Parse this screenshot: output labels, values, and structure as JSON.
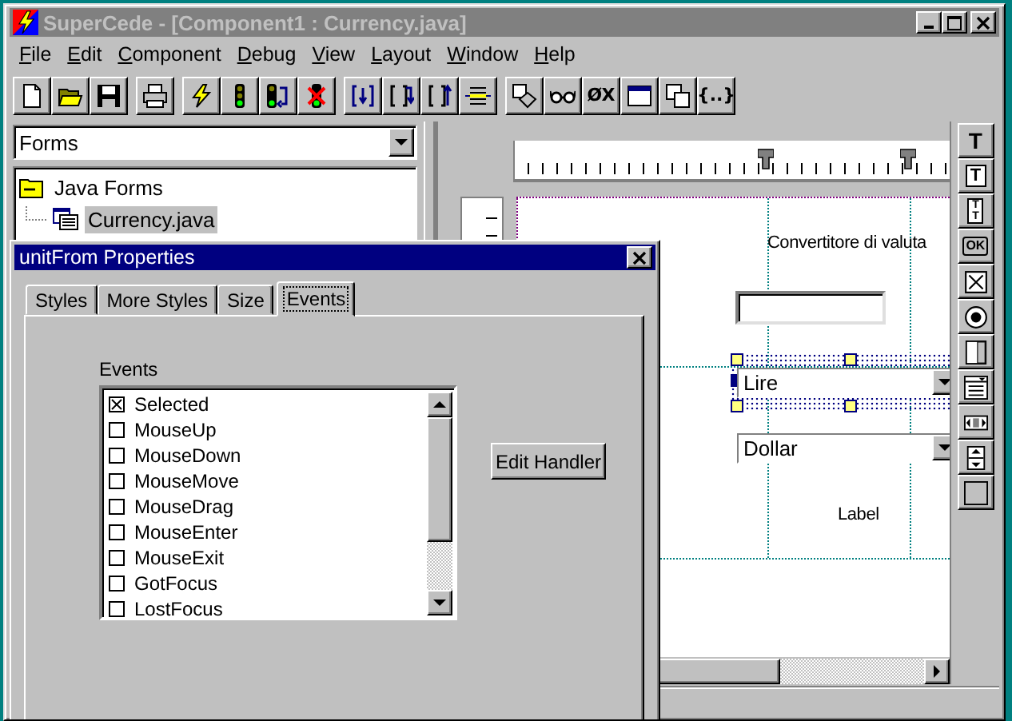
{
  "window": {
    "title": "SuperCede - [Component1 : Currency.java]",
    "active": false
  },
  "menu": [
    "File",
    "Edit",
    "Component",
    "Debug",
    "View",
    "Layout",
    "Window",
    "Help"
  ],
  "toolbar": [
    {
      "buttons": [
        {
          "kind": "new"
        },
        {
          "kind": "open"
        },
        {
          "kind": "save"
        }
      ]
    },
    {
      "buttons": [
        {
          "kind": "print"
        }
      ]
    },
    {
      "buttons": [
        {
          "kind": "lightning"
        },
        {
          "kind": "traffic"
        },
        {
          "kind": "traffic-arrow"
        },
        {
          "kind": "traffic-cross"
        }
      ]
    },
    {
      "buttons": [
        {
          "kind": "bracket-down"
        },
        {
          "kind": "bracket-right"
        },
        {
          "kind": "bracket-up"
        },
        {
          "kind": "center"
        }
      ]
    },
    {
      "buttons": [
        {
          "kind": "shapes"
        },
        {
          "kind": "glasses"
        },
        {
          "kind": "glyph",
          "label": "ØX"
        },
        {
          "kind": "window"
        },
        {
          "kind": "copy"
        },
        {
          "kind": "glyph",
          "label": "{..}"
        }
      ]
    }
  ],
  "forms_dropdown": {
    "value": "Forms"
  },
  "tree": [
    {
      "label": "Java Forms",
      "expanded": true,
      "children": [
        {
          "label": "Currency.java",
          "selected": true
        }
      ]
    }
  ],
  "designer": {
    "components": [
      {
        "kind": "label",
        "text": "Convertitore di valuta"
      },
      {
        "kind": "textfield"
      },
      {
        "kind": "combo",
        "value": "Lire",
        "selected": true
      },
      {
        "kind": "combo",
        "value": "Dollar",
        "selected": false
      },
      {
        "kind": "label",
        "text": "Label"
      }
    ]
  },
  "palette": [
    {
      "kind": "glyph",
      "label": "T"
    },
    {
      "kind": "textfield",
      "label": "T"
    },
    {
      "kind": "textarea",
      "labels": [
        "T",
        "T"
      ]
    },
    {
      "kind": "glyph-box",
      "label": "OK"
    },
    {
      "kind": "checkbox"
    },
    {
      "kind": "radio"
    },
    {
      "kind": "vscroll"
    },
    {
      "kind": "list"
    },
    {
      "kind": "hscroll"
    },
    {
      "kind": "spinner"
    },
    {
      "kind": "frame"
    }
  ],
  "dialog": {
    "title": "unitFrom Properties",
    "tabs": [
      {
        "label": "Styles",
        "selected": false
      },
      {
        "label": "More Styles",
        "selected": false
      },
      {
        "label": "Size",
        "selected": false
      },
      {
        "label": "Events",
        "selected": true
      }
    ],
    "list_label": "Events",
    "events": [
      {
        "label": "Selected",
        "checked": true
      },
      {
        "label": "MouseUp",
        "checked": false
      },
      {
        "label": "MouseDown",
        "checked": false
      },
      {
        "label": "MouseMove",
        "checked": false
      },
      {
        "label": "MouseDrag",
        "checked": false
      },
      {
        "label": "MouseEnter",
        "checked": false
      },
      {
        "label": "MouseExit",
        "checked": false
      },
      {
        "label": "GotFocus",
        "checked": false
      },
      {
        "label": "LostFocus",
        "checked": false
      }
    ],
    "button": "Edit Handler"
  }
}
